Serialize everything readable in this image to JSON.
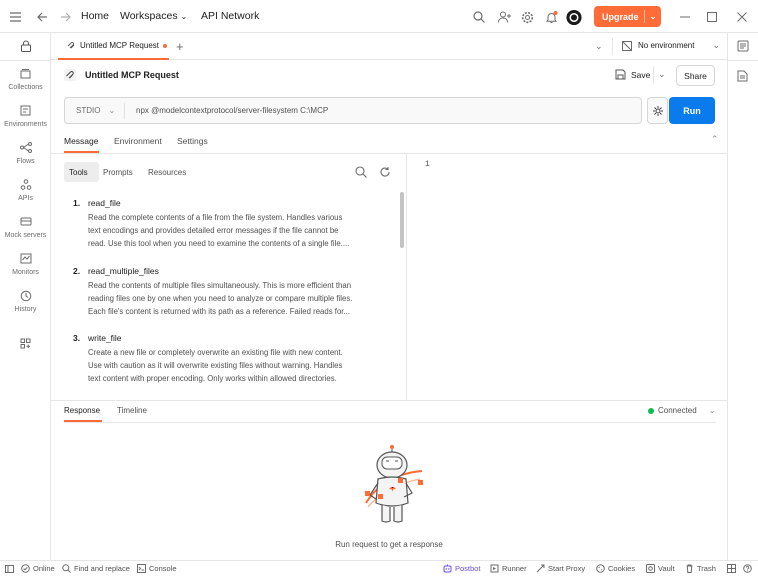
{
  "topbar": {
    "home": "Home",
    "workspaces": "Workspaces",
    "api_network": "API Network",
    "upgrade": "Upgrade"
  },
  "sidebar": {
    "items": [
      {
        "label": "Collections"
      },
      {
        "label": "Environments"
      },
      {
        "label": "Flows"
      },
      {
        "label": "APIs"
      },
      {
        "label": "Mock servers"
      },
      {
        "label": "Monitors"
      },
      {
        "label": "History"
      }
    ]
  },
  "tabstrip": {
    "tab_label": "Untitled MCP Request",
    "environment": "No environment"
  },
  "request": {
    "title": "Untitled MCP Request",
    "save": "Save",
    "share": "Share",
    "transport": "STDIO",
    "command": "npx @modelcontextprotocol/server-filesystem C:\\MCP",
    "run": "Run"
  },
  "request_tabs": [
    "Message",
    "Environment",
    "Settings"
  ],
  "tools_tabs": [
    "Tools",
    "Prompts",
    "Resources"
  ],
  "tools": [
    {
      "num": "1.",
      "name": "read_file",
      "desc": [
        "Read the complete contents of a file from the file system. Handles various",
        "text encodings and provides detailed error messages if the file cannot be",
        "read. Use this tool when you need to examine the contents of a single file...."
      ]
    },
    {
      "num": "2.",
      "name": "read_multiple_files",
      "desc": [
        "Read the contents of multiple files simultaneously. This is more efficient than",
        "reading files one by one when you need to analyze or compare multiple files.",
        "Each file's content is returned with its path as a reference. Failed reads for..."
      ]
    },
    {
      "num": "3.",
      "name": "write_file",
      "desc": [
        "Create a new file or completely overwrite an existing file with new content.",
        "Use with caution as it will overwrite existing files without warning. Handles",
        "text content with proper encoding. Only works within allowed directories."
      ]
    }
  ],
  "editor": {
    "line_number": "1"
  },
  "response": {
    "tabs": [
      "Response",
      "Timeline"
    ],
    "status": "Connected",
    "empty_message": "Run request to get a response"
  },
  "statusbar": {
    "online": "Online",
    "find_replace": "Find and replace",
    "console": "Console",
    "postbot": "Postbot",
    "runner": "Runner",
    "start_proxy": "Start Proxy",
    "cookies": "Cookies",
    "vault": "Vault",
    "trash": "Trash"
  },
  "colors": {
    "accent": "#ff6c37",
    "run_blue": "#097bed",
    "connected_green": "#0cbb52",
    "postbot_purple": "#6b4fd8"
  }
}
